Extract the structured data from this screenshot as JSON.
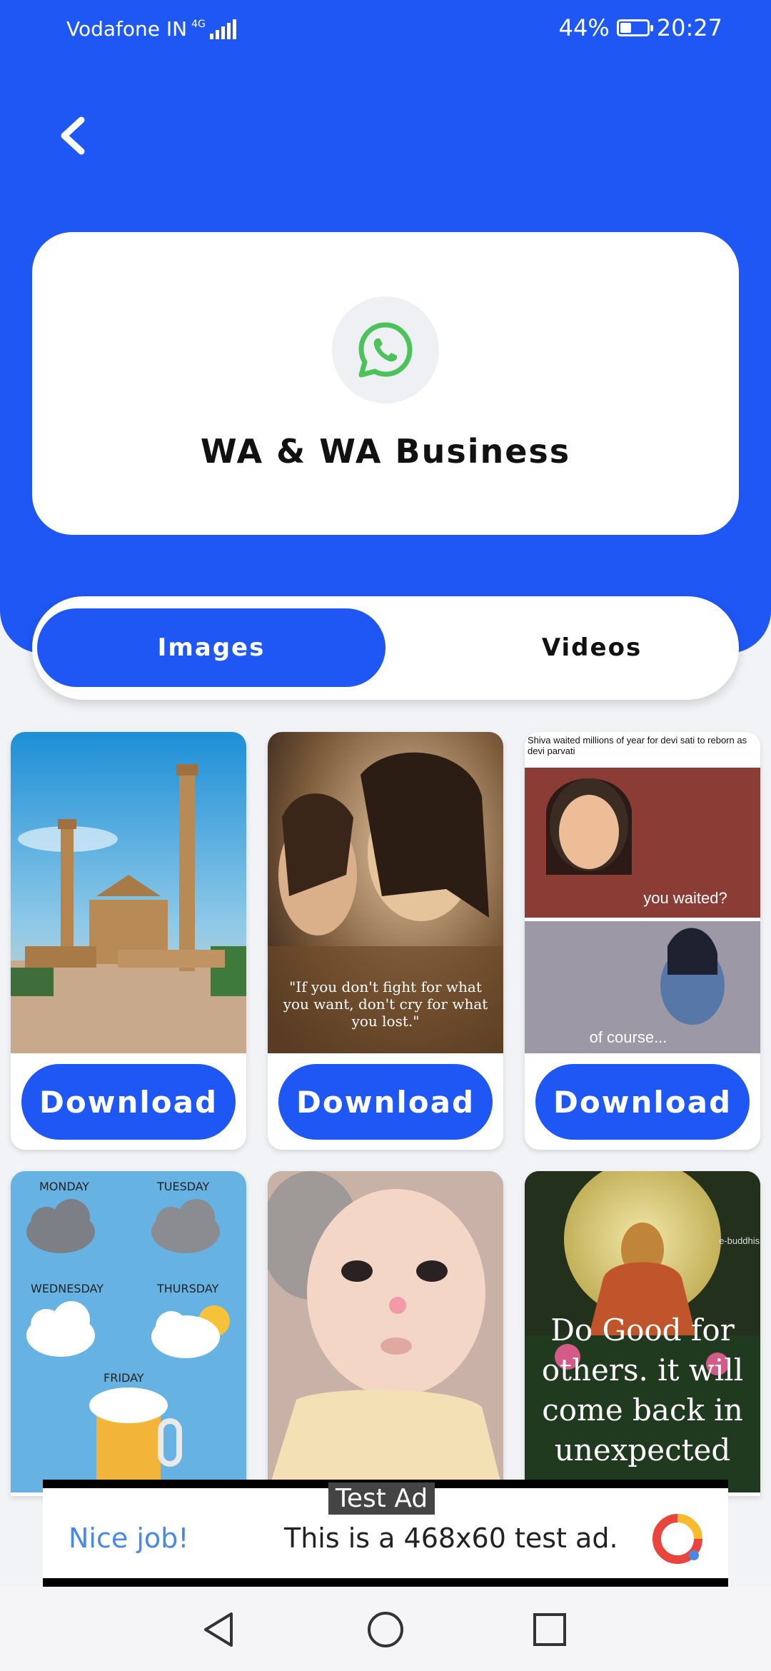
{
  "status": {
    "carrier": "Vodafone IN",
    "network": "4G",
    "battery_percent": "44%",
    "battery_level": 0.44,
    "time": "20:27"
  },
  "header": {
    "back_icon": "chevron-left-icon",
    "app_icon": "whatsapp-icon",
    "title": "WA & WA Business"
  },
  "tabs": [
    {
      "label": "Images",
      "active": true
    },
    {
      "label": "Videos",
      "active": false
    }
  ],
  "tiles": [
    {
      "download_label": "Download",
      "caption": ""
    },
    {
      "download_label": "Download",
      "caption": "\"If you don't fight for what you want, don't cry for what you lost.\""
    },
    {
      "download_label": "Download",
      "caption_top": "Shiva waited millions of year for devi sati to reborn as devi parvati",
      "caption_mid": "you waited?",
      "caption_bottom": "of course..."
    },
    {
      "labels": [
        "MONDAY",
        "TUESDAY",
        "WEDNESDAY",
        "THURSDAY",
        "FRIDAY"
      ]
    },
    {
      "caption": ""
    },
    {
      "caption": "Do Good for others. it will come back in unexpected ways.",
      "watermark": "e-buddhism"
    }
  ],
  "ad": {
    "tag": "Test Ad",
    "headline": "Nice job!",
    "text": "This is a 468x60 test ad."
  },
  "colors": {
    "primary": "#1f57f5",
    "whatsapp": "#4cc35a"
  }
}
